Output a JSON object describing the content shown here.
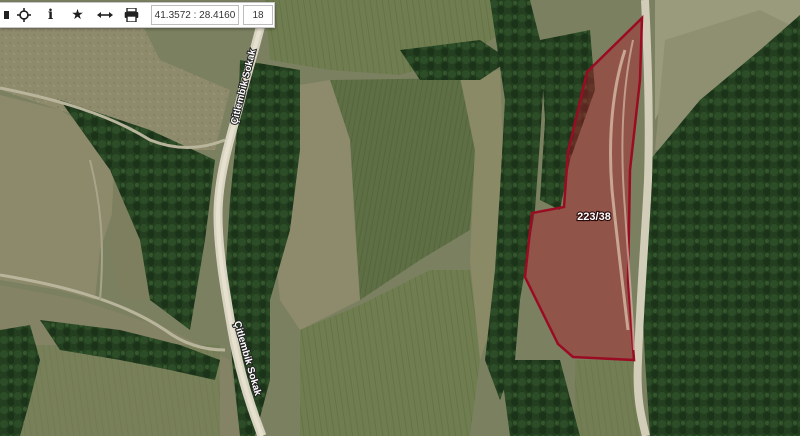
{
  "toolbar": {
    "items": [
      {
        "name": "first-toolbar-button",
        "icon": "partial-icon"
      },
      {
        "name": "locate-button",
        "icon": "crosshair-icon"
      },
      {
        "name": "info-button",
        "icon": "info-icon",
        "glyph": "i"
      },
      {
        "name": "favorite-button",
        "icon": "star-icon",
        "glyph": "★"
      },
      {
        "name": "measure-button",
        "icon": "horizontal-arrows-icon"
      },
      {
        "name": "print-button",
        "icon": "printer-icon"
      }
    ],
    "coordinates": "41.3572 : 28.4160",
    "zoom": "18"
  },
  "map": {
    "parcel_label": "223/38",
    "road_label_top": "Çitlembik Sokak",
    "road_label_bottom": "Çitlembik Sokak",
    "parcel_color": "#b0182c",
    "forest_color": "#1f3a1b",
    "field_color": "#6d7b4f",
    "road_color": "#d8d2c0"
  }
}
